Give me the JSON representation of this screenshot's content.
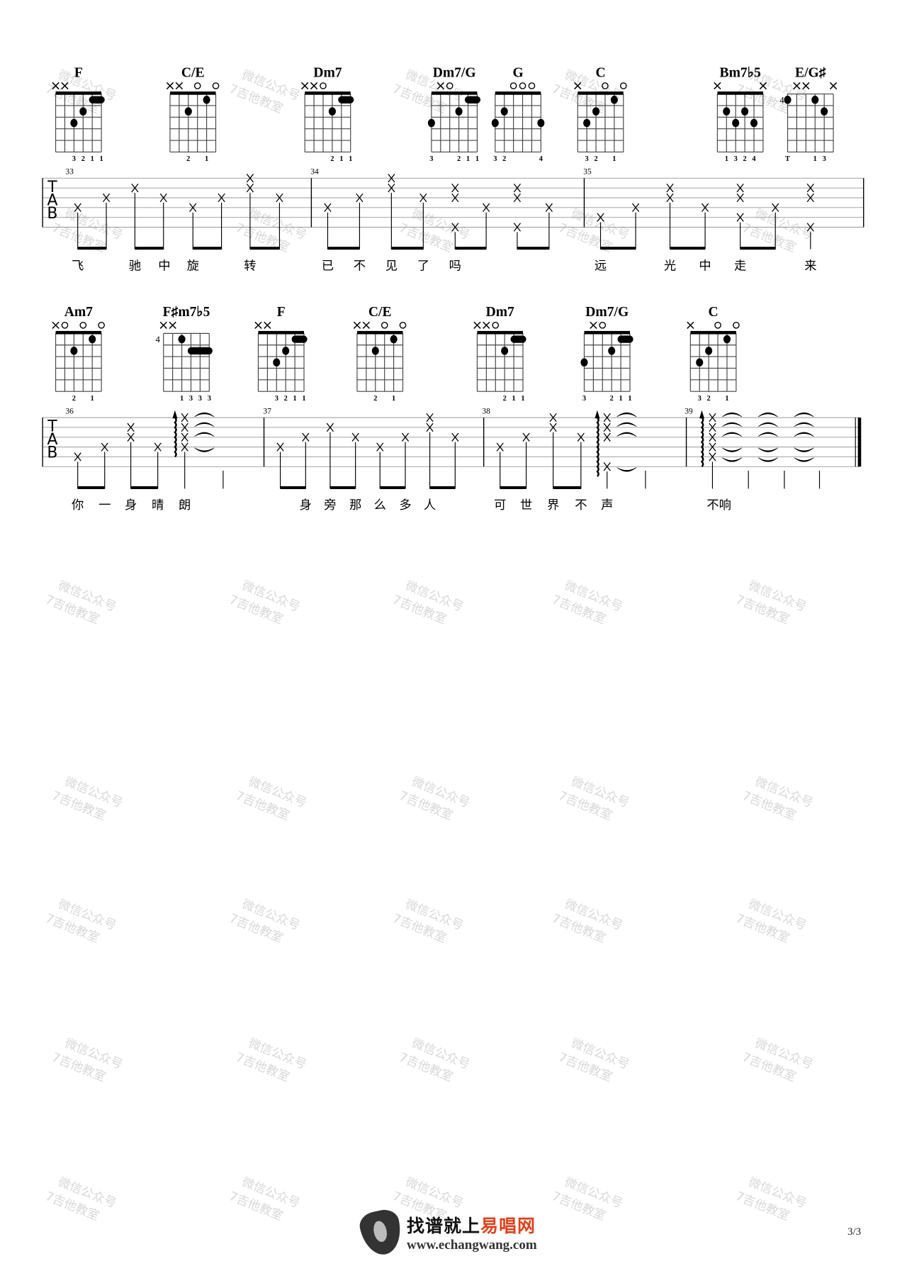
{
  "watermark": {
    "line1": "微信公众号",
    "line2": "7吉他教室"
  },
  "systems": [
    {
      "chords": [
        {
          "name": "F",
          "markers": [
            "x",
            "x",
            "",
            "",
            "",
            ""
          ],
          "base_fret": 1,
          "dots": [
            [
              3,
              3
            ],
            [
              4,
              2
            ]
          ],
          "barres": [
            [
              5,
              6,
              1
            ]
          ],
          "fingers": [
            "",
            "",
            "3",
            "2",
            "1",
            "1"
          ]
        },
        {
          "name": "C/E",
          "markers": [
            "x",
            "x",
            "",
            "o",
            "",
            "o"
          ],
          "base_fret": 1,
          "dots": [
            [
              3,
              2
            ],
            [
              5,
              1
            ]
          ],
          "barres": [],
          "fingers": [
            "",
            "",
            "2",
            "",
            "1",
            ""
          ]
        },
        {
          "name": "Dm7",
          "markers": [
            "x",
            "x",
            "o",
            "",
            "",
            ""
          ],
          "base_fret": 1,
          "dots": [
            [
              4,
              2
            ]
          ],
          "barres": [
            [
              5,
              6,
              1
            ]
          ],
          "fingers": [
            "",
            "",
            "",
            "2",
            "1",
            "1"
          ]
        },
        {
          "name": "Dm7/G",
          "markers": [
            "",
            "x",
            "o",
            "",
            "",
            ""
          ],
          "base_fret": 1,
          "dots": [
            [
              1,
              3
            ],
            [
              4,
              2
            ]
          ],
          "barres": [
            [
              5,
              6,
              1
            ]
          ],
          "fingers": [
            "3",
            "",
            "",
            "2",
            "1",
            "1"
          ]
        },
        {
          "name": "G",
          "markers": [
            "",
            "",
            "o",
            "o",
            "o",
            ""
          ],
          "base_fret": 1,
          "dots": [
            [
              1,
              3
            ],
            [
              2,
              2
            ],
            [
              6,
              3
            ]
          ],
          "barres": [],
          "fingers": [
            "3",
            "2",
            "",
            "",
            "",
            "4"
          ]
        },
        {
          "name": "C",
          "markers": [
            "x",
            "",
            "",
            "o",
            "",
            "o"
          ],
          "base_fret": 1,
          "dots": [
            [
              2,
              3
            ],
            [
              3,
              2
            ],
            [
              5,
              1
            ]
          ],
          "barres": [],
          "fingers": [
            "",
            "3",
            "2",
            "",
            "1",
            ""
          ]
        },
        {
          "name": "Bm7♭5",
          "markers": [
            "x",
            "",
            "",
            "",
            "",
            "x"
          ],
          "base_fret": 1,
          "dots": [
            [
              2,
              2
            ],
            [
              3,
              3
            ],
            [
              4,
              2
            ],
            [
              5,
              3
            ]
          ],
          "barres": [],
          "fingers": [
            "",
            "1",
            "3",
            "2",
            "4",
            ""
          ]
        },
        {
          "name": "E/G♯",
          "markers": [
            "",
            "x",
            "x",
            "",
            "",
            "x"
          ],
          "base_fret": 4,
          "dots": [
            [
              1,
              1
            ],
            [
              4,
              1
            ],
            [
              5,
              2
            ]
          ],
          "barres": [],
          "fingers": [
            "T",
            "",
            "",
            "1",
            "3",
            ""
          ]
        }
      ],
      "measures": [
        {
          "number": "33",
          "notes": [
            [
              4
            ],
            [
              3
            ],
            [
              2
            ],
            [
              3
            ],
            [
              4
            ],
            [
              3
            ],
            [
              1,
              2
            ],
            [
              3
            ]
          ],
          "beams": [
            [
              0,
              1
            ],
            [
              2,
              3
            ],
            [
              4,
              5
            ],
            [
              6,
              7
            ]
          ]
        },
        {
          "number": "34",
          "notes": [
            [
              4
            ],
            [
              3
            ],
            [
              1,
              2
            ],
            [
              3
            ],
            [
              2,
              3,
              6
            ],
            [
              4
            ],
            [
              2,
              3,
              6
            ],
            [
              4
            ]
          ],
          "beams": [
            [
              0,
              1
            ],
            [
              2,
              3
            ],
            [
              4,
              5
            ],
            [
              6,
              7
            ]
          ]
        },
        {
          "number": "35",
          "notes": [
            [
              5
            ],
            [
              4
            ],
            [
              2,
              3
            ],
            [
              4
            ],
            [
              2,
              3,
              5
            ],
            [
              4
            ],
            [
              2,
              3,
              6
            ]
          ],
          "beams": [
            [
              0,
              1
            ],
            [
              2,
              3
            ],
            [
              4,
              5
            ]
          ]
        }
      ],
      "lyrics": [
        "飞",
        "驰",
        "中",
        "旋",
        "转",
        "已",
        "不",
        "见",
        "了",
        "吗",
        "远",
        "光",
        "中",
        "走",
        "来"
      ]
    },
    {
      "chords": [
        {
          "name": "Am7",
          "markers": [
            "x",
            "o",
            "",
            "o",
            "",
            "o"
          ],
          "base_fret": 1,
          "dots": [
            [
              3,
              2
            ],
            [
              5,
              1
            ]
          ],
          "barres": [],
          "fingers": [
            "",
            "",
            "2",
            "",
            "1",
            ""
          ]
        },
        {
          "name": "F♯m7♭5",
          "markers": [
            "x",
            "x",
            "",
            "",
            "",
            ""
          ],
          "base_fret": 4,
          "dots": [
            [
              3,
              1
            ]
          ],
          "barres": [
            [
              4,
              6,
              2
            ]
          ],
          "fingers": [
            "",
            "",
            "1",
            "3",
            "3",
            "3"
          ]
        },
        {
          "name": "F",
          "markers": [
            "x",
            "x",
            "",
            "",
            "",
            ""
          ],
          "base_fret": 1,
          "dots": [
            [
              3,
              3
            ],
            [
              4,
              2
            ]
          ],
          "barres": [
            [
              5,
              6,
              1
            ]
          ],
          "fingers": [
            "",
            "",
            "3",
            "2",
            "1",
            "1"
          ]
        },
        {
          "name": "C/E",
          "markers": [
            "x",
            "x",
            "",
            "o",
            "",
            "o"
          ],
          "base_fret": 1,
          "dots": [
            [
              3,
              2
            ],
            [
              5,
              1
            ]
          ],
          "barres": [],
          "fingers": [
            "",
            "",
            "2",
            "",
            "1",
            ""
          ]
        },
        {
          "name": "Dm7",
          "markers": [
            "x",
            "x",
            "o",
            "",
            "",
            ""
          ],
          "base_fret": 1,
          "dots": [
            [
              4,
              2
            ]
          ],
          "barres": [
            [
              5,
              6,
              1
            ]
          ],
          "fingers": [
            "",
            "",
            "",
            "2",
            "1",
            "1"
          ]
        },
        {
          "name": "Dm7/G",
          "markers": [
            "",
            "x",
            "o",
            "",
            "",
            ""
          ],
          "base_fret": 1,
          "dots": [
            [
              1,
              3
            ],
            [
              4,
              2
            ]
          ],
          "barres": [
            [
              5,
              6,
              1
            ]
          ],
          "fingers": [
            "3",
            "",
            "",
            "2",
            "1",
            "1"
          ]
        },
        {
          "name": "C",
          "markers": [
            "x",
            "",
            "",
            "o",
            "",
            "o"
          ],
          "base_fret": 1,
          "dots": [
            [
              2,
              3
            ],
            [
              3,
              2
            ],
            [
              5,
              1
            ]
          ],
          "barres": [],
          "fingers": [
            "",
            "3",
            "2",
            "",
            "1",
            ""
          ]
        }
      ],
      "measures": [
        {
          "number": "36",
          "notes": [
            [
              5
            ],
            [
              4
            ],
            [
              2,
              3
            ],
            [
              4
            ],
            [
              1,
              2,
              3,
              4
            ]
          ],
          "beams": [
            [
              0,
              1
            ],
            [
              2,
              3
            ]
          ],
          "strum_before": 4
        },
        {
          "number": "37",
          "notes": [
            [
              4
            ],
            [
              3
            ],
            [
              2
            ],
            [
              3
            ],
            [
              4
            ],
            [
              3
            ],
            [
              1,
              2
            ],
            [
              3
            ]
          ],
          "beams": [
            [
              0,
              1
            ],
            [
              2,
              3
            ],
            [
              4,
              5
            ],
            [
              6,
              7
            ]
          ]
        },
        {
          "number": "38",
          "notes": [
            [
              4
            ],
            [
              3
            ],
            [
              1,
              2
            ],
            [
              3
            ],
            [
              1,
              2,
              3,
              6
            ]
          ],
          "beams": [
            [
              0,
              1
            ],
            [
              2,
              3
            ]
          ],
          "strum_before": 4
        },
        {
          "number": "39",
          "notes": [
            [
              1,
              2,
              3,
              4,
              5
            ]
          ],
          "beams": [],
          "strum_before": 0
        }
      ],
      "lyrics": [
        "你",
        "一",
        "身",
        "晴",
        "朗",
        "身",
        "旁",
        "那",
        "么",
        "多",
        "人",
        "可",
        "世",
        "界",
        "不",
        "声",
        "不响"
      ]
    }
  ],
  "footer": {
    "logo_black": "找谱就上",
    "logo_red": "易唱网",
    "url": "www.echangwang.com",
    "page": "3/3",
    "accent_color": "#e0401a"
  }
}
